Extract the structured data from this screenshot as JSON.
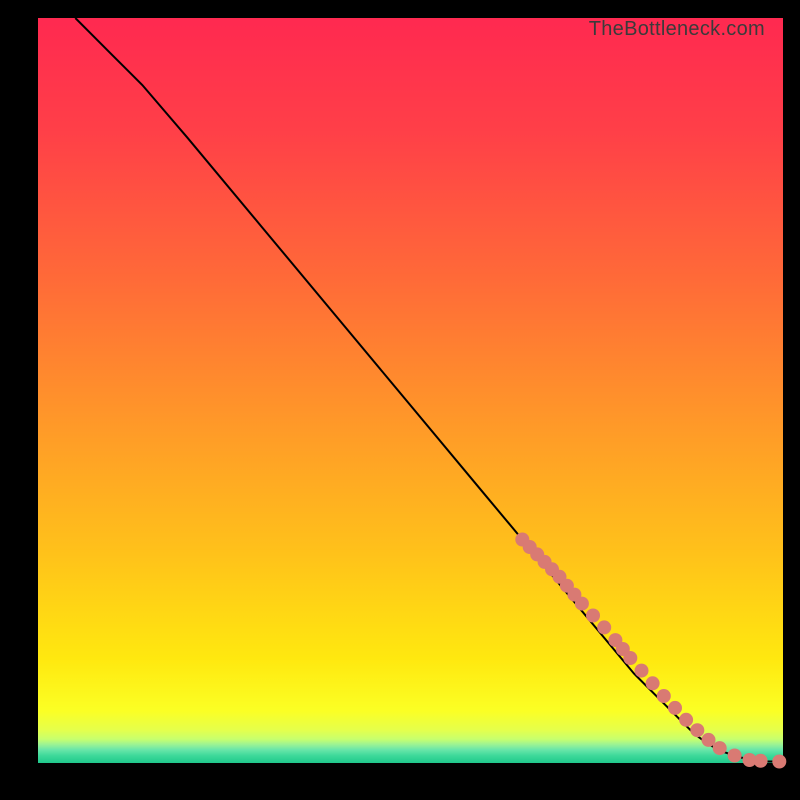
{
  "watermark": {
    "text": "TheBottleneck.com"
  },
  "gradient_stops": [
    "#ff2950",
    "#ff3f48",
    "#ff6a38",
    "#ff9a28",
    "#ffc21a",
    "#ffe80f",
    "#fbff24",
    "#e6ff4a",
    "#c7ff6e",
    "#9cf393",
    "#6ae6a9",
    "#3ed99a",
    "#20c98c"
  ],
  "chart_data": {
    "type": "line",
    "title": "",
    "xlabel": "",
    "ylabel": "",
    "xlim": [
      0,
      100
    ],
    "ylim": [
      0,
      100
    ],
    "grid": false,
    "legend": false,
    "series": [
      {
        "name": "bottleneck-curve",
        "x": [
          5,
          7,
          10,
          14,
          20,
          30,
          40,
          50,
          60,
          65,
          70,
          75,
          80,
          85,
          88,
          90,
          92,
          94,
          96,
          98,
          100
        ],
        "y": [
          100,
          98,
          95,
          91,
          84,
          72,
          60,
          48,
          36,
          30,
          24,
          18,
          12,
          7,
          4,
          2.5,
          1.5,
          0.8,
          0.4,
          0.2,
          0.2
        ]
      }
    ],
    "markers": {
      "name": "highlight-points",
      "color": "#d97a73",
      "r": 7,
      "x": [
        65,
        66,
        67,
        68,
        69,
        70,
        71,
        72,
        73,
        74.5,
        76,
        77.5,
        78.5,
        79.5,
        81,
        82.5,
        84,
        85.5,
        87,
        88.5,
        90,
        91.5,
        93.5,
        95.5,
        97,
        99.5
      ],
      "y": [
        30,
        29,
        28,
        27,
        26,
        25,
        23.8,
        22.6,
        21.4,
        19.8,
        18.2,
        16.5,
        15.3,
        14.1,
        12.4,
        10.7,
        9.0,
        7.4,
        5.8,
        4.4,
        3.1,
        2.0,
        1.0,
        0.4,
        0.3,
        0.2
      ]
    }
  }
}
